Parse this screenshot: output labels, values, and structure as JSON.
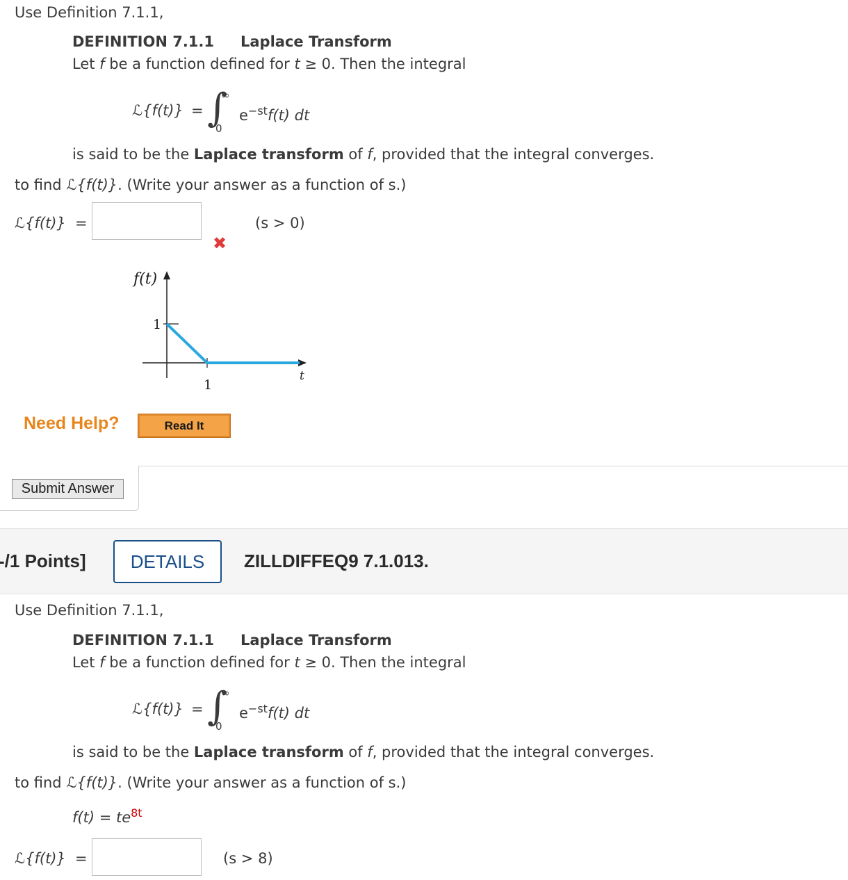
{
  "q1": {
    "intro": "Use Definition 7.1.1,",
    "def_label": "DEFINITION 7.1.1",
    "def_name": "Laplace Transform",
    "def_line_let": "Let ",
    "def_line_f": "f",
    "def_line_mid": " be a function defined for ",
    "def_line_t": "t",
    "def_line_end": " ≥ 0. Then the integral",
    "formula_lhs": "ℒ{f(t)}",
    "formula_eq": "=",
    "int_upper": "∞",
    "int_lower": "0",
    "integrand_e": "e",
    "integrand_exp": "−st",
    "integrand_rest": "f(t) dt",
    "said_pre": "is said to be the ",
    "said_bold": "Laplace transform",
    "said_mid": " of ",
    "said_f": "f",
    "said_post": ", provided that the integral converges.",
    "find_pre": "to find ",
    "find_expr": "ℒ{f(t)}",
    "find_post": ". (Write your answer as a function of s.)",
    "answer_lhs": "ℒ{f(t)}",
    "answer_eq": "=",
    "answer_value": "",
    "condition": "(s > 0)",
    "wrong_mark": "✖",
    "graph": {
      "ylabel": "f(t)",
      "xlabel": "t",
      "ytick": "1",
      "xtick": "1",
      "line_color": "#29a8e0"
    }
  },
  "help": {
    "title": "Need Help?",
    "read_it": "Read It"
  },
  "submit_label": "Submit Answer",
  "q2_header": {
    "points": "-/1 Points]",
    "details": "DETAILS",
    "id": "ZILLDIFFEQ9 7.1.013."
  },
  "q2": {
    "intro": "Use Definition 7.1.1,",
    "def_label": "DEFINITION 7.1.1",
    "def_name": "Laplace Transform",
    "def_line_let": "Let ",
    "def_line_f": "f",
    "def_line_mid": " be a function defined for ",
    "def_line_t": "t",
    "def_line_end": " ≥ 0. Then the integral",
    "formula_lhs": "ℒ{f(t)}",
    "formula_eq": "=",
    "int_upper": "∞",
    "int_lower": "0",
    "integrand_e": "e",
    "integrand_exp": "−st",
    "integrand_rest": "f(t) dt",
    "said_pre": "is said to be the ",
    "said_bold": "Laplace transform",
    "said_mid": " of ",
    "said_f": "f",
    "said_post": ", provided that the integral converges.",
    "find_pre": "to find ",
    "find_expr": "ℒ{f(t)}",
    "find_post": ". (Write your answer as a function of s.)",
    "given_lhs": "f(t) = ",
    "given_base": "te",
    "given_exp": "8t",
    "given_exp_color": "#cc0000",
    "answer_lhs": "ℒ{f(t)}",
    "answer_eq": "=",
    "answer_value": "",
    "condition": "(s > 8)"
  }
}
